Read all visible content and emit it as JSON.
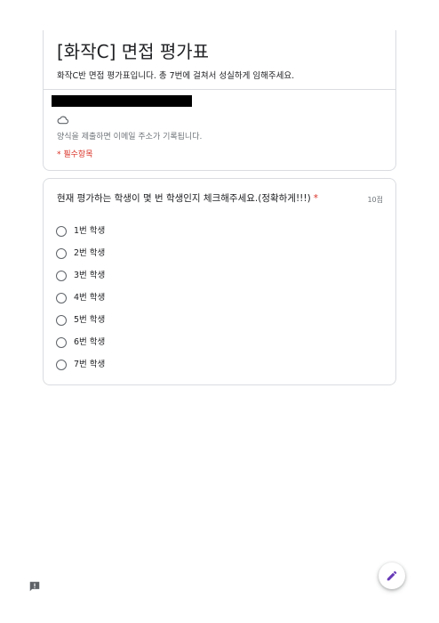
{
  "form": {
    "title": "[화작C] 면접 평가표",
    "description": "화작C반 면접 평가표입니다. 총 7번에 걸쳐서 성실하게 임해주세요.",
    "email_note": "양식을 제출하면 이메일 주소가 기록됩니다.",
    "required_note": "* 필수항목"
  },
  "question": {
    "title": "현재 평가하는 학생이 몇 번 학생인지 체크해주세요.(정확하게!!!)",
    "required_mark": "*",
    "points": "10점",
    "options": [
      {
        "label": "1번 학생"
      },
      {
        "label": "2번 학생"
      },
      {
        "label": "3번 학생"
      },
      {
        "label": "4번 학생"
      },
      {
        "label": "5번 학생"
      },
      {
        "label": "6번 학생"
      },
      {
        "label": "7번 학생"
      }
    ]
  },
  "icons": {
    "cloud": "cloud-off-icon",
    "report": "report-icon",
    "edit": "edit-icon"
  },
  "colors": {
    "required": "#d93025",
    "fab_icon": "#673ab7",
    "border": "#dadce0"
  }
}
